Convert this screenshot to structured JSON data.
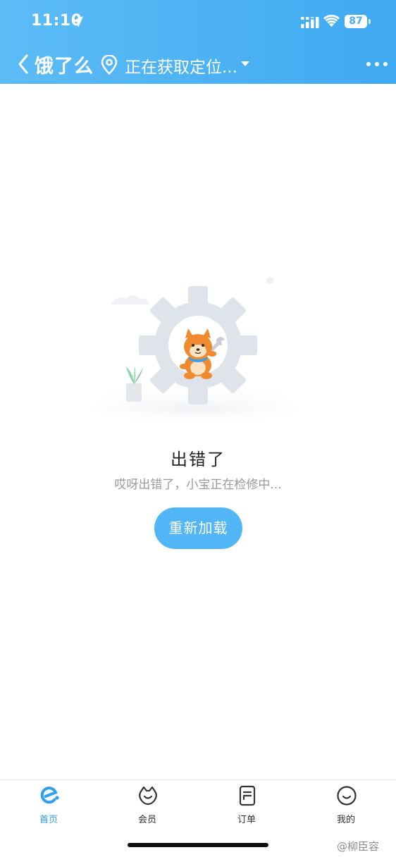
{
  "status_bar": {
    "time": "11:10",
    "battery": "87"
  },
  "nav": {
    "title": "饿了么",
    "location": "正在获取定位..."
  },
  "error": {
    "title": "出错了",
    "description": "哎呀出错了，小宝正在检修中...",
    "reload_label": "重新加载"
  },
  "tabs": [
    {
      "label": "首页",
      "icon": "home-icon",
      "active": true
    },
    {
      "label": "会员",
      "icon": "member-icon",
      "active": false
    },
    {
      "label": "订单",
      "icon": "order-icon",
      "active": false
    },
    {
      "label": "我的",
      "icon": "profile-icon",
      "active": false
    }
  ],
  "watermark": "@柳臣容",
  "colors": {
    "header_gradient_start": "#5cbcf6",
    "header_gradient_end": "#3fa9f1",
    "accent": "#52b5f5",
    "active_tab": "#2d9ff0"
  }
}
